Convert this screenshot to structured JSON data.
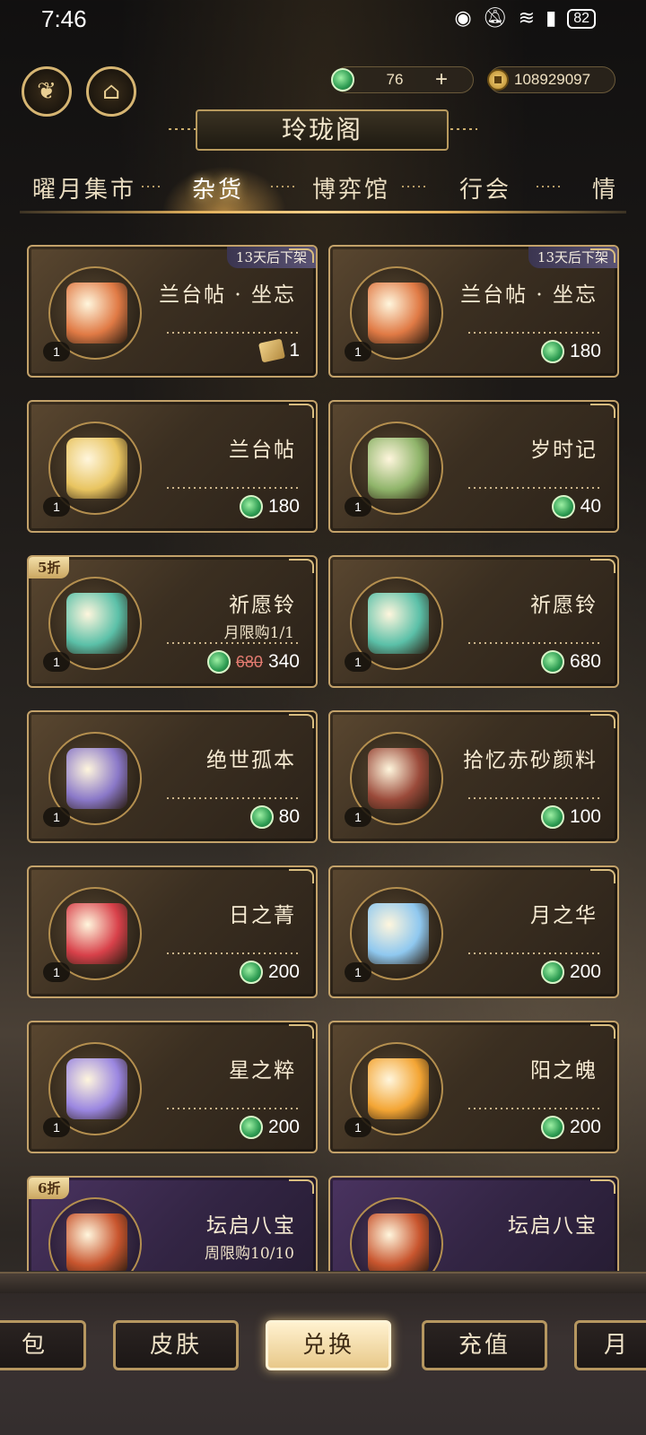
{
  "status_bar": {
    "time": "7:46",
    "battery": "82"
  },
  "header": {
    "jade_amount": "76",
    "plus_label": "+",
    "coin_amount": "108929097",
    "title": "玲珑阁"
  },
  "tabs": [
    "曜月集市",
    "杂货",
    "博弈馆",
    "行会",
    "情"
  ],
  "active_tab": "杂货",
  "items": [
    {
      "name": "兰台帖 · 坐忘",
      "qty": "1",
      "price": "1",
      "currency": "ticket",
      "ribbon": "13天后下架",
      "art_color": "#e07a45"
    },
    {
      "name": "兰台帖 · 坐忘",
      "qty": "1",
      "price": "180",
      "currency": "jade",
      "ribbon": "13天后下架",
      "art_color": "#e07a45"
    },
    {
      "name": "兰台帖",
      "qty": "1",
      "price": "180",
      "currency": "jade",
      "art_color": "#e8c460"
    },
    {
      "name": "岁时记",
      "qty": "1",
      "price": "40",
      "currency": "jade",
      "art_color": "#8fb46a"
    },
    {
      "name": "祈愿铃",
      "qty": "1",
      "limit": "月限购1/1",
      "old_price": "680",
      "price": "340",
      "currency": "jade",
      "discount": "5折",
      "art_color": "#5bc0a8"
    },
    {
      "name": "祈愿铃",
      "qty": "1",
      "price": "680",
      "currency": "jade",
      "art_color": "#5bc0a8"
    },
    {
      "name": "绝世孤本",
      "qty": "1",
      "price": "80",
      "currency": "jade",
      "art_color": "#8a78c8"
    },
    {
      "name": "拾忆赤砂颜料",
      "qty": "1",
      "price": "100",
      "currency": "jade",
      "art_color": "#9a4a3a"
    },
    {
      "name": "日之菁",
      "qty": "1",
      "price": "200",
      "currency": "jade",
      "art_color": "#d8414a"
    },
    {
      "name": "月之华",
      "qty": "1",
      "price": "200",
      "currency": "jade",
      "art_color": "#8fc8ef"
    },
    {
      "name": "星之粹",
      "qty": "1",
      "price": "200",
      "currency": "jade",
      "art_color": "#9a86e0"
    },
    {
      "name": "阳之魄",
      "qty": "1",
      "price": "200",
      "currency": "jade",
      "art_color": "#f3a534"
    },
    {
      "name": "坛启八宝",
      "qty": "1",
      "limit": "周限购10/10",
      "discount": "6折",
      "currency": "jade",
      "purple": true,
      "art_color": "#c8552e"
    },
    {
      "name": "坛启八宝",
      "qty": "1",
      "currency": "jade",
      "purple": true,
      "art_color": "#c8552e"
    }
  ],
  "bottom_tabs": [
    "包",
    "皮肤",
    "兑换",
    "充值",
    "月"
  ],
  "active_bottom_tab": "兑换"
}
